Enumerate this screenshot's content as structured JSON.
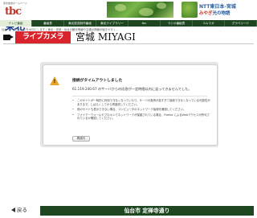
{
  "header": {
    "logo_small": "東北放送ホームページ",
    "logo_big_a": "tbc",
    "logo_big_b": "東北",
    "banner2_line1": "NTT東日本-宮城",
    "banner2_line2a": "みやぎ",
    "banner2_line2b": "光の物語"
  },
  "nav": {
    "tabs": [
      "テレビ番組",
      "番組表",
      "東北放送制作番組",
      "東北ライブラリー",
      "tbc",
      "ラジオ番組表",
      "エルマガ",
      "グラベリード"
    ],
    "active_index": 0
  },
  "breadcrumb": "仙台ページとリンクを大切にします / 東北・宮城・仙台の観光情報や交通の情報が届きやすく…",
  "title": {
    "live_camera": "ライブカメラ",
    "prefecture": "宮城 MIYAGI"
  },
  "error": {
    "title": "接続がタイムアウトしました",
    "description": "61.119.240.67 のサーバからの応答が一定時間以内に返ってきませんでした。",
    "bullets": [
      "このサイトが一時的に利用できなくなっていたり、サーバの負荷が高すぎて接続できなくなっている可能性があります。しばらくしてから再度試してください。",
      "他のサイトも表示できない場合、コンピュータのネットワーク接続を確認してください。",
      "ファイアーウォールやプロキシでネットワークが保護されている場合、Firefox によるWebアクセスが許可されているか確認してください。"
    ],
    "retry_label": "再試行"
  },
  "footer": {
    "back_label": "戻る",
    "location": "仙台市 定禅寺通り"
  },
  "colors": {
    "accent_red": "#d9232d",
    "nav_green": "#1e4620",
    "warning": "#e8a52a"
  }
}
